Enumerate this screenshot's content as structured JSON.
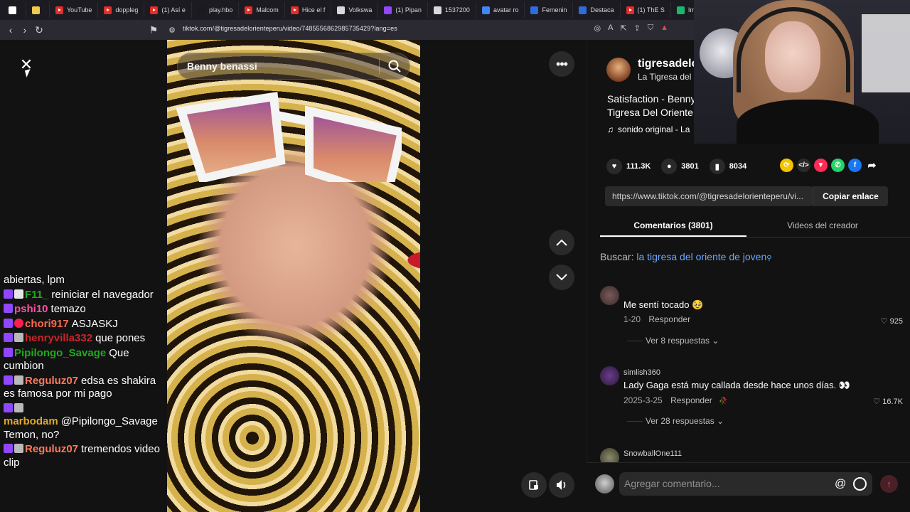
{
  "browser": {
    "tabs": [
      {
        "label": "",
        "color": "#ffffff"
      },
      {
        "label": "",
        "color": "#f2c94c"
      },
      {
        "label": "YouTube",
        "color": "#e52d27"
      },
      {
        "label": "doppleg",
        "color": "#e52d27"
      },
      {
        "label": "(1) Así e",
        "color": "#e52d27"
      },
      {
        "label": "play.hbo",
        "color": "#1a1a1a"
      },
      {
        "label": "Malcom",
        "color": "#e52d27"
      },
      {
        "label": "Hice el f",
        "color": "#e52d27"
      },
      {
        "label": "Volkswa",
        "color": "#d9d9d9"
      },
      {
        "label": "(1) Pipan",
        "color": "#9146ff"
      },
      {
        "label": "1537200",
        "color": "#d9d9d9"
      },
      {
        "label": "avatar ro",
        "color": "#4285f4"
      },
      {
        "label": "Femenin",
        "color": "#2d6cdf"
      },
      {
        "label": "Destaca",
        "color": "#2d6cdf"
      },
      {
        "label": "(1) ThE S",
        "color": "#e52d27"
      },
      {
        "label": "Imgur: T",
        "color": "#1bb76e"
      },
      {
        "label": "",
        "color": "#e52d27"
      }
    ],
    "url": "tiktok.com/@tigresadelorienteperu/video/7485556862985735429?lang=es"
  },
  "chat": [
    {
      "badges": [],
      "user": "",
      "user_color": "#ffffff",
      "text": "abiertas, lpm"
    },
    {
      "badges": [
        "sub",
        "gift"
      ],
      "user": "F11_",
      "user_color": "#1eab1e",
      "text": "reiniciar el navegador"
    },
    {
      "badges": [
        "sub"
      ],
      "user": "pshi10",
      "user_color": "#ff4fa3",
      "text": "temazo"
    },
    {
      "badges": [
        "sub",
        "heart"
      ],
      "user": "chori917",
      "user_color": "#ff6a4d",
      "text": "ASJASKJ"
    },
    {
      "badges": [
        "sub",
        "mod"
      ],
      "user": "henryvilla332",
      "user_color": "#c8262a",
      "text": "que pones"
    },
    {
      "badges": [
        "sub"
      ],
      "user": "Pipilongo_Savage",
      "user_color": "#1eab1e",
      "text": "Que cumbion"
    },
    {
      "badges": [
        "sub",
        "mod"
      ],
      "user": "Reguluz07",
      "user_color": "#ff7a5a",
      "text": "edsa es shakira es famosa por mi pago"
    },
    {
      "badges": [
        "sub",
        "mod"
      ],
      "user": "marbodam",
      "user_color": "#e0a82e",
      "text": "@Pipilongo_Savage Temon, no?"
    },
    {
      "badges": [
        "sub",
        "mod"
      ],
      "user": "Reguluz07",
      "user_color": "#ff7a5a",
      "text": "tremendos video clip"
    }
  ],
  "video": {
    "search_value": "Benny benassi"
  },
  "author": {
    "name": "tigresadelc",
    "subtitle": "La Tigresa del",
    "description": "Satisfaction - Benny Tigresa Del Oriente",
    "sound": "sonido original - La"
  },
  "actions": {
    "likes": "111.3K",
    "comments": "3801",
    "saves": "8034"
  },
  "share": {
    "link": "https://www.tiktok.com/@tigresadelorienteperu/vi...",
    "copy_label": "Copiar enlace"
  },
  "tabs": {
    "comments": "Comentarios (3801)",
    "creator_videos": "Videos del creador"
  },
  "search_suggest": {
    "prefix": "Buscar:",
    "query": "la tigresa del oriente de joven"
  },
  "comments": [
    {
      "user": "",
      "text": "Me sentí tocado 🥹",
      "date": "1-20",
      "reply": "Responder",
      "likes": "925",
      "more": "Ver 8 respuestas"
    },
    {
      "user": "simlish360",
      "text": "Lady Gaga está muy callada desde hace unos días. 👀",
      "date": "2025-3-25",
      "reply": "Responder",
      "likes": "16.7K",
      "more": "Ver 28 respuestas"
    },
    {
      "user": "SnowballOne111",
      "text": "",
      "date": "",
      "reply": "",
      "likes": "",
      "more": ""
    }
  ],
  "comment_input": {
    "placeholder": "Agregar comentario..."
  }
}
